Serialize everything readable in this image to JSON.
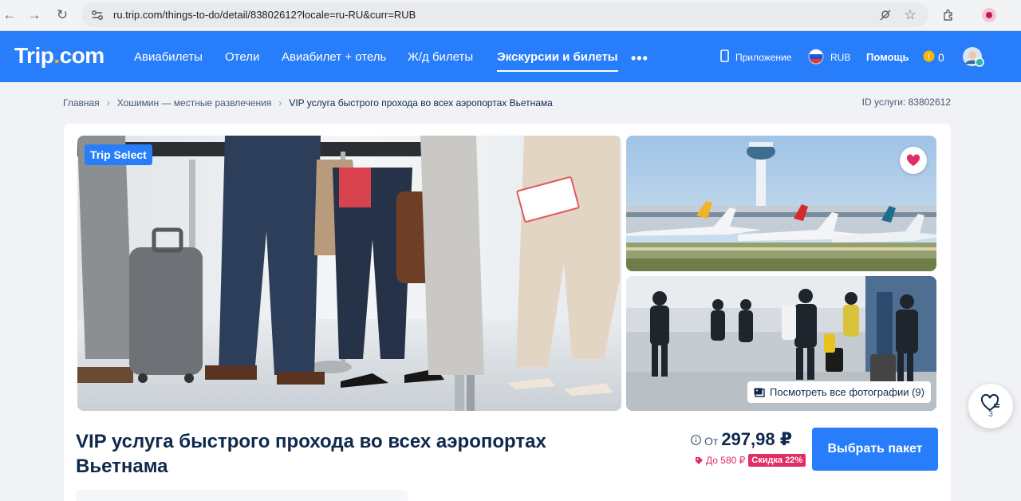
{
  "browser": {
    "url": "ru.trip.com/things-to-do/detail/83802612?locale=ru-RU&curr=RUB"
  },
  "header": {
    "logo_main": "Trip",
    "logo_dot": ".",
    "logo_tail": "com",
    "menu": [
      "Авиабилеты",
      "Отели",
      "Авиабилет + отель",
      "Ж/д билеты",
      "Экскурсии и билеты"
    ],
    "app_label": "Приложение",
    "currency": "RUB",
    "help": "Помощь",
    "coins": "0"
  },
  "breadcrumb": {
    "home": "Главная",
    "city": "Хошимин — местные развлечения",
    "current": "VIP услуга быстрого прохода во всех аэропортах Вьетнама"
  },
  "product_id": "ID услуги: 83802612",
  "gallery": {
    "badge": "Trip Select",
    "view_all": "Посмотреть все фотографии (9)"
  },
  "wishlist_count": "3",
  "product": {
    "title": "VIP услуга быстрого прохода во всех аэропортах Вьетнама",
    "price_from": "От",
    "price": "297,98 ₽",
    "discount_upto": "До 580 ₽",
    "discount_badge": "Скидка 22%",
    "cta": "Выбрать пакет"
  },
  "colors": {
    "brand": "#287dfa",
    "discount": "#e12d64",
    "favorite": "#e12d64"
  }
}
